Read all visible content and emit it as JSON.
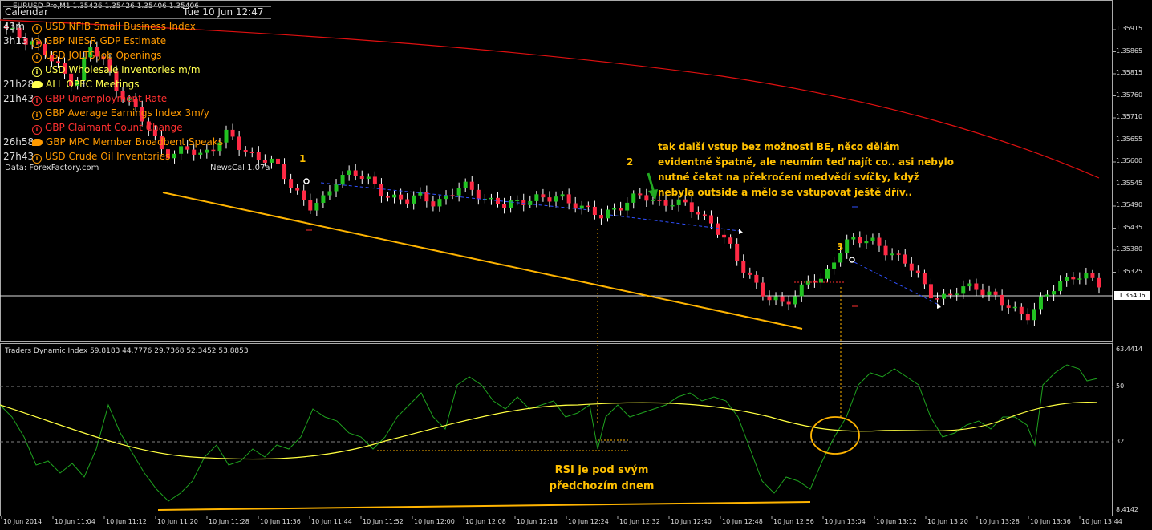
{
  "window": {
    "symbol_title": "EURUSD-Pro,M1  1.35426 1.35426 1.35406 1.35406"
  },
  "calendar": {
    "header_label": "Calendar",
    "header_date": "Tue 10 Jun 12:47",
    "rows": [
      {
        "time": "43m",
        "currency": "USD",
        "event": "NFIB Small Business Index",
        "impact": "medium"
      },
      {
        "time": "3h13",
        "currency": "GBP",
        "event": "NIESR GDP Estimate",
        "impact": "medium"
      },
      {
        "time": "",
        "currency": "USD",
        "event": "JOLTS Job Openings",
        "impact": "medium"
      },
      {
        "time": "",
        "currency": "USD",
        "event": "Wholesale Inventories m/m",
        "impact": "low"
      },
      {
        "time": "21h28",
        "currency": "ALL",
        "event": "OPEC Meetings",
        "impact": "speech-low"
      },
      {
        "time": "21h43",
        "currency": "GBP",
        "event": "Unemployment Rate",
        "impact": "high"
      },
      {
        "time": "",
        "currency": "GBP",
        "event": "Average Earnings Index 3m/y",
        "impact": "medium"
      },
      {
        "time": "",
        "currency": "GBP",
        "event": "Claimant Count Change",
        "impact": "high"
      },
      {
        "time": "26h58",
        "currency": "GBP",
        "event": "MPC Member Broadbent Speaks",
        "impact": "speech-medium"
      },
      {
        "time": "27h43",
        "currency": "USD",
        "event": "Crude Oil Inventories",
        "impact": "medium"
      }
    ],
    "footer_source": "Data: ForexFactory.com",
    "footer_version": "NewsCal 1.07a",
    "impact_colors": {
      "high": "#ff3030",
      "medium": "#ff9a00",
      "low": "#ffff50"
    }
  },
  "annotations": {
    "marker_1": "1",
    "marker_2": "2",
    "marker_3": "3",
    "comment_lines": [
      "tak další vstup bez možnosti BE, něco dělám",
      "evidentně špatně, ale neumím teď najít co.. asi nebylo",
      "nutné čekat na překročení medvědí svíčky, když",
      "nebyla outside a mělo se vstupovat ještě dřív.."
    ],
    "rsi_note_lines": [
      "RSI je pod svým",
      "předchozím dnem"
    ]
  },
  "indicator": {
    "title": "Traders Dynamic Index 59.8183 44.7776 29.7368 52.3452 53.8853",
    "levels": [
      "63.4414",
      "50",
      "32",
      "8.4142"
    ]
  },
  "price_axis": {
    "labels": [
      "1.35915",
      "1.35865",
      "1.35815",
      "1.35760",
      "1.35710",
      "1.35655",
      "1.35600",
      "1.35545",
      "1.35490",
      "1.35435",
      "1.35380",
      "1.35325"
    ],
    "current": "1.35406"
  },
  "time_axis": {
    "labels": [
      "10 Jun 2014",
      "10 Jun 11:04",
      "10 Jun 11:12",
      "10 Jun 11:20",
      "10 Jun 11:28",
      "10 Jun 11:36",
      "10 Jun 11:44",
      "10 Jun 11:52",
      "10 Jun 12:00",
      "10 Jun 12:08",
      "10 Jun 12:16",
      "10 Jun 12:24",
      "10 Jun 12:32",
      "10 Jun 12:40",
      "10 Jun 12:48",
      "10 Jun 12:56",
      "10 Jun 13:04",
      "10 Jun 13:12",
      "10 Jun 13:20",
      "10 Jun 13:28",
      "10 Jun 13:36",
      "10 Jun 13:44"
    ]
  },
  "colors": {
    "bull": "#22c322",
    "bear": "#ff2a45",
    "ma": "#e01010",
    "trend": "#ffb400",
    "rsi_line": "#1fa31f",
    "signal_line": "#ffff40",
    "grid_dash": "#808080"
  },
  "chart_data": {
    "type": "candlestick",
    "price_range": [
      1.353,
      1.35945
    ],
    "close_prices": [
      1.359,
      1.3589,
      1.3588,
      1.3585,
      1.3582,
      1.358,
      1.3587,
      1.3584,
      1.3579,
      1.3576,
      1.3572,
      1.3568,
      1.3566,
      1.3567,
      1.3566,
      1.3568,
      1.357,
      1.3567,
      1.3566,
      1.3565,
      1.3562,
      1.3559,
      1.3556,
      1.3557,
      1.3562,
      1.3563,
      1.3561,
      1.3559,
      1.3558,
      1.3557,
      1.3558,
      1.3557,
      1.3558,
      1.356,
      1.3559,
      1.3557,
      1.3556,
      1.3557,
      1.3558,
      1.3557,
      1.3558,
      1.3557,
      1.3555,
      1.3554,
      1.3556,
      1.3557,
      1.3558,
      1.3557,
      1.3557,
      1.3556,
      1.3555,
      1.3553,
      1.3549,
      1.3545,
      1.3542,
      1.3538,
      1.3537,
      1.3539,
      1.3542,
      1.3541,
      1.3547,
      1.355,
      1.3549,
      1.3549,
      1.3547,
      1.3545,
      1.3542,
      1.3539,
      1.3538,
      1.354,
      1.3541,
      1.3539,
      1.3537,
      1.3536,
      1.3535,
      1.3538,
      1.3541,
      1.3543,
      1.3542,
      1.3541
    ]
  }
}
